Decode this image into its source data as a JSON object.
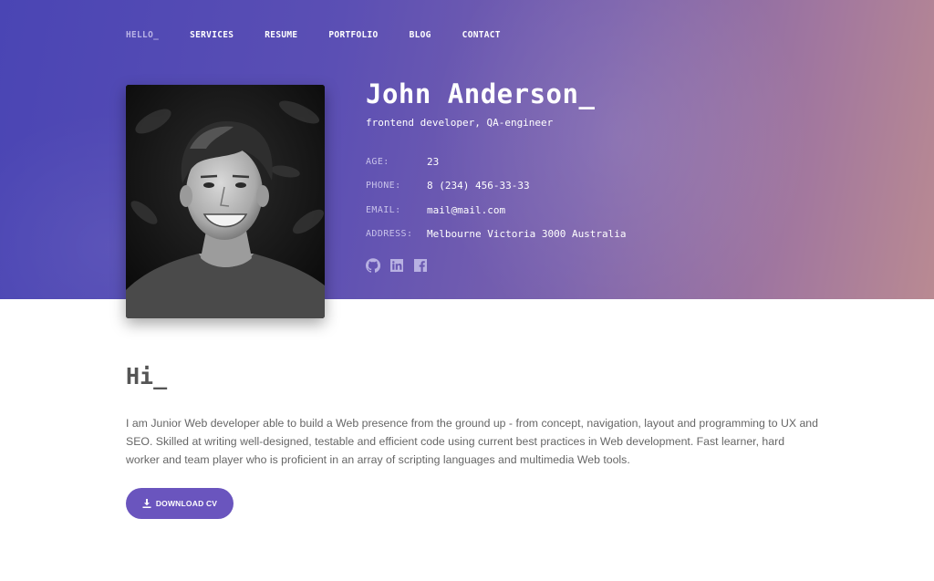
{
  "nav": {
    "items": [
      {
        "label": "HELLO_",
        "active": true
      },
      {
        "label": "SERVICES",
        "active": false
      },
      {
        "label": "RESUME",
        "active": false
      },
      {
        "label": "PORTFOLIO",
        "active": false
      },
      {
        "label": "BLOG",
        "active": false
      },
      {
        "label": "CONTACT",
        "active": false
      }
    ]
  },
  "profile": {
    "name": "John Anderson_",
    "subtitle": "frontend developer, QA-engineer",
    "info": [
      {
        "label": "AGE:",
        "value": "23"
      },
      {
        "label": "PHONE:",
        "value": "8 (234) 456-33-33"
      },
      {
        "label": "EMAIL:",
        "value": "mail@mail.com"
      },
      {
        "label": "ADDRESS:",
        "value": "Melbourne Victoria 3000 Australia"
      }
    ],
    "social": [
      "github-icon",
      "linkedin-icon",
      "facebook-icon"
    ]
  },
  "about": {
    "heading": "Hi_",
    "text": "I am Junior Web developer able to build a Web presence from the ground up - from concept, navigation, layout and programming to UX and SEO. Skilled at writing well-designed, testable and efficient code using current best practices in Web development. Fast learner, hard worker and team player who is proficient in an array of scripting languages and multimedia Web tools.",
    "button_label": "DOWNLOAD CV"
  },
  "colors": {
    "accent": "#6a55be",
    "hero_gradient_start": "#4a45b4",
    "hero_gradient_end": "#b98a92",
    "nav_active": "#b9b3e6"
  }
}
